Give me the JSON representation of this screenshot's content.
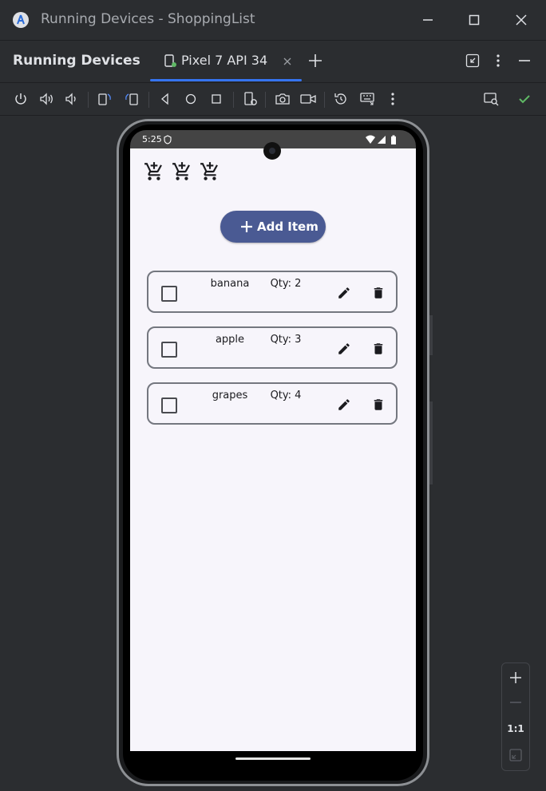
{
  "window": {
    "title": "Running Devices - ShoppingList"
  },
  "tool_window": {
    "title": "Running Devices",
    "tab_label": "Pixel 7 API 34"
  },
  "phone": {
    "status_time": "5:25",
    "add_button_label": "Add Item",
    "items": [
      {
        "name": "banana",
        "qty": "Qty: 2",
        "checked": false
      },
      {
        "name": "apple",
        "qty": "Qty: 3",
        "checked": false
      },
      {
        "name": "grapes",
        "qty": "Qty: 4",
        "checked": false
      }
    ]
  },
  "zoom": {
    "actual_size_label": "1:1"
  },
  "colors": {
    "ide_background": "#2b2d30",
    "tab_underline": "#3574f0",
    "app_background": "#f7f5fb",
    "add_button": "#4a5a93",
    "check_icon": "#5fb865"
  }
}
